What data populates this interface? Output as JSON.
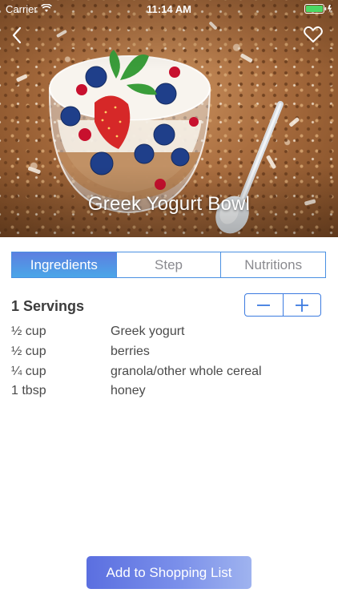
{
  "status_bar": {
    "carrier": "Carrier",
    "time": "11:14 AM",
    "icons": [
      "wifi-icon",
      "battery-icon"
    ],
    "battery_color": "#4cd964"
  },
  "nav": {
    "back_icon": "chevron-left-icon",
    "favorite_icon": "heart-outline-icon"
  },
  "hero": {
    "title": "Greek Yogurt Bowl"
  },
  "tabs": [
    {
      "label": "Ingredients",
      "active": true
    },
    {
      "label": "Step",
      "active": false
    },
    {
      "label": "Nutritions",
      "active": false
    }
  ],
  "servings": {
    "label": "1 Servings",
    "decrement_icon": "minus-icon",
    "increment_icon": "plus-icon"
  },
  "ingredients": [
    {
      "qty": "½ cup",
      "name": "Greek yogurt"
    },
    {
      "qty": "½ cup",
      "name": "berries"
    },
    {
      "qty": "¼ cup",
      "name": "granola/other whole cereal"
    },
    {
      "qty": "1 tbsp",
      "name": "honey"
    }
  ],
  "actions": {
    "add_to_list": "Add to Shopping List"
  },
  "colors": {
    "accent": "#4a90e2",
    "tab_active": "#5d7fe0",
    "button_gradient_start": "#5b6fe0",
    "button_gradient_end": "#9fb3ef"
  }
}
